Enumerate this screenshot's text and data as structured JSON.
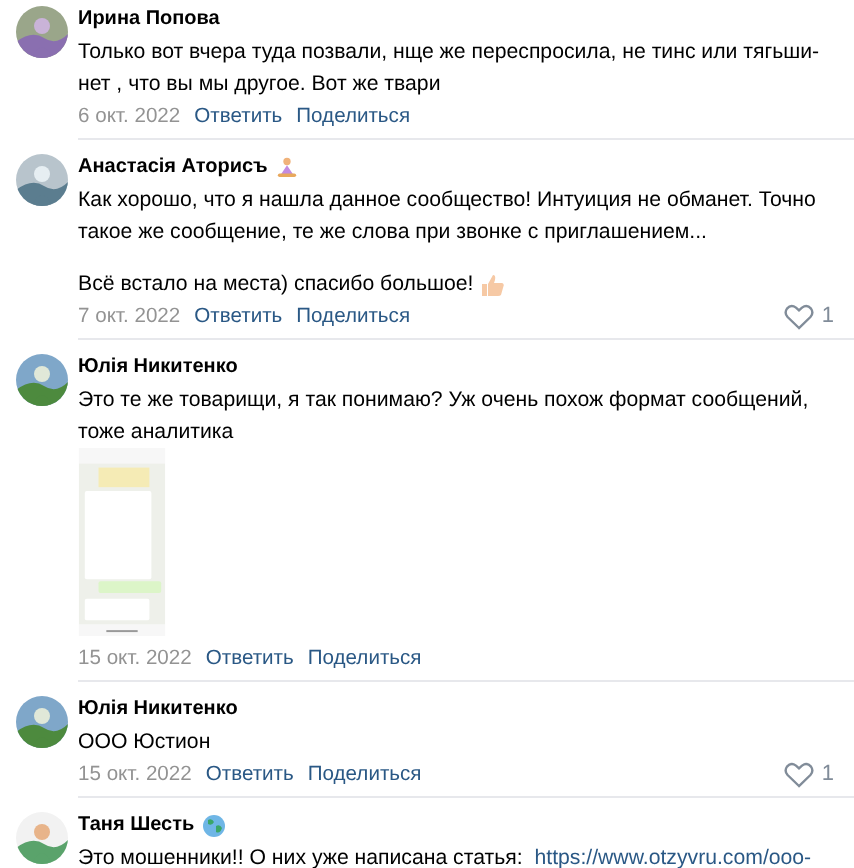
{
  "comments": [
    {
      "author": "Ирина Попова",
      "avatar": {
        "kind": "picture"
      },
      "paragraphs": [
        {
          "text": "Только вот вчера туда позвали, нще же переспросила, не тинс или тягьши-\nнет , что вы мы другое. Вот же твари"
        }
      ],
      "date": "6 окт. 2022",
      "actions": [
        "Ответить",
        "Поделиться"
      ]
    },
    {
      "author": "Анастасія Аторисъ",
      "badge": {
        "kind": "meditation"
      },
      "avatar": {
        "kind": "picture"
      },
      "paragraphs": [
        {
          "text": "Как хорошо, что я нашла данное сообщество! Интуиция не обманет. Точно\nтакое же сообщение, те же слова при звонке с приглашением..."
        },
        {
          "text": "Всё встало на места) спасибо большое!",
          "emoji": {
            "kind": "thumbs-up"
          }
        }
      ],
      "date": "7 окт. 2022",
      "actions": [
        "Ответить",
        "Поделиться"
      ],
      "likes": "1"
    },
    {
      "author": "Юлія Никитенко",
      "avatar": {
        "kind": "picture"
      },
      "paragraphs": [
        {
          "text": "Это те же товарищи, я так понимаю? Уж очень похож формат сообщений,\nтоже аналитика"
        }
      ],
      "attachment": {
        "kind": "picture"
      },
      "date": "15 окт. 2022",
      "actions": [
        "Ответить",
        "Поделиться"
      ]
    },
    {
      "author": "Юлія Никитенко",
      "avatar": {
        "kind": "picture"
      },
      "paragraphs": [
        {
          "text": "ООО Юстион"
        }
      ],
      "date": "15 окт. 2022",
      "actions": [
        "Ответить",
        "Поделиться"
      ],
      "likes": "1"
    },
    {
      "author": "Таня Шесть",
      "badge": {
        "kind": "globe"
      },
      "avatar": {
        "kind": "picture"
      },
      "paragraphs": [
        {
          "text": "Это мошенники!! О них уже написана статья: ",
          "link": "https://www.otzyvru.com/ooo-"
        }
      ]
    }
  ]
}
